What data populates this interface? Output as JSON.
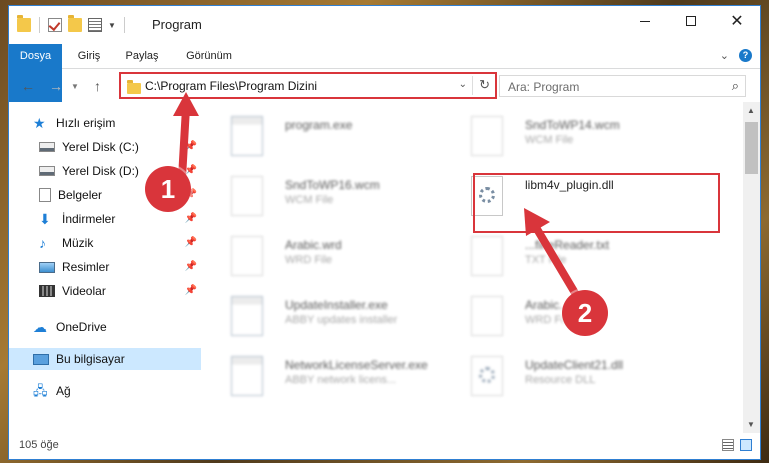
{
  "window": {
    "title": "Program",
    "controls": {
      "minimize": "—",
      "maximize": "☐",
      "close": "✕"
    }
  },
  "ribbon": {
    "tabs": [
      "Dosya",
      "Giriş",
      "Paylaş",
      "Görünüm"
    ]
  },
  "navigation": {
    "address": "C:\\Program Files\\Program Dizini",
    "search_placeholder": "Ara: Program"
  },
  "sidebar": {
    "items": [
      {
        "label": "Hızlı erişim",
        "icon": "star-icon"
      },
      {
        "label": "Yerel Disk (C:)",
        "icon": "drive-icon",
        "pinned": true
      },
      {
        "label": "Yerel Disk (D:)",
        "icon": "drive-icon",
        "pinned": true
      },
      {
        "label": "Belgeler",
        "icon": "documents-icon",
        "pinned": true
      },
      {
        "label": "İndirmeler",
        "icon": "downloads-icon",
        "pinned": true
      },
      {
        "label": "Müzik",
        "icon": "music-icon",
        "pinned": true
      },
      {
        "label": "Resimler",
        "icon": "pictures-icon",
        "pinned": true
      },
      {
        "label": "Videolar",
        "icon": "videos-icon",
        "pinned": true
      },
      {
        "label": "OneDrive",
        "icon": "cloud-icon"
      },
      {
        "label": "Bu bilgisayar",
        "icon": "computer-icon",
        "selected": true
      },
      {
        "label": "Ağ",
        "icon": "network-icon"
      }
    ]
  },
  "files": [
    {
      "name": "program.exe",
      "type": ""
    },
    {
      "name": "SndToWP14.wcm",
      "type": "WCM File"
    },
    {
      "name": "SndToWP16.wcm",
      "type": "WCM File"
    },
    {
      "name": "libm4v_plugin.dll",
      "type": ""
    },
    {
      "name": "Arabic.wrd",
      "type": "WRD File"
    },
    {
      "name": "...fineReader.txt",
      "type": "TXT File"
    },
    {
      "name": "UpdateInstaller.exe",
      "type": "ABBY updates installer"
    },
    {
      "name": "Arabic...",
      "type": "WRD File"
    },
    {
      "name": "NetworkLicenseServer.exe",
      "type": "ABBY network licens..."
    },
    {
      "name": "UpdateClient21.dll",
      "type": "Resource DLL"
    }
  ],
  "status": {
    "item_count": "105 öğe"
  },
  "callouts": [
    "1",
    "2"
  ],
  "colors": {
    "accent": "#1979ca",
    "highlight": "#d9353b",
    "selection": "#cce8ff"
  }
}
